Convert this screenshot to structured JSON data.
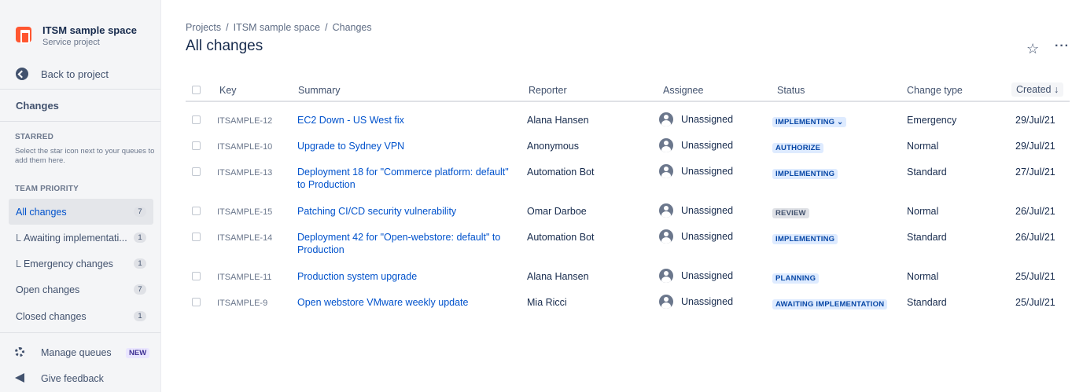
{
  "project": {
    "name": "ITSM sample space",
    "type": "Service project"
  },
  "sidebar": {
    "back_label": "Back to project",
    "section_title": "Changes",
    "starred_heading": "STARRED",
    "starred_hint": "Select the star icon next to your queues to add them here.",
    "team_priority_heading": "TEAM PRIORITY",
    "queues": [
      {
        "label": "All changes",
        "count": "7",
        "sub": false,
        "active": true
      },
      {
        "label": "Awaiting implementati...",
        "count": "1",
        "sub": true,
        "active": false
      },
      {
        "label": "Emergency changes",
        "count": "1",
        "sub": true,
        "active": false
      },
      {
        "label": "Open changes",
        "count": "7",
        "sub": false,
        "active": false
      },
      {
        "label": "Closed changes",
        "count": "1",
        "sub": false,
        "active": false
      }
    ],
    "manage_queues": "Manage queues",
    "new_badge": "NEW",
    "give_feedback": "Give feedback",
    "sub_prefix": "L"
  },
  "breadcrumb": [
    "Projects",
    "ITSM sample space",
    "Changes"
  ],
  "breadcrumb_sep": "/",
  "page_title": "All changes",
  "more_label": "···",
  "star_glyph": "☆",
  "table": {
    "headers": {
      "key": "Key",
      "summary": "Summary",
      "reporter": "Reporter",
      "assignee": "Assignee",
      "status": "Status",
      "change_type": "Change type",
      "created": "Created ↓"
    },
    "rows": [
      {
        "key": "ITSAMPLE-12",
        "summary": "EC2 Down - US West fix",
        "reporter": "Alana Hansen",
        "assignee": "Unassigned",
        "status": "IMPLEMENTING ⌄",
        "status_color": "blue",
        "change_type": "Emergency",
        "created": "29/Jul/21"
      },
      {
        "key": "ITSAMPLE-10",
        "summary": "Upgrade to Sydney VPN",
        "reporter": "Anonymous",
        "assignee": "Unassigned",
        "status": "AUTHORIZE",
        "status_color": "blue",
        "change_type": "Normal",
        "created": "29/Jul/21"
      },
      {
        "key": "ITSAMPLE-13",
        "summary": "Deployment 18 for \"Commerce platform: default\" to Production",
        "reporter": "Automation Bot",
        "assignee": "Unassigned",
        "status": "IMPLEMENTING",
        "status_color": "blue",
        "change_type": "Standard",
        "created": "27/Jul/21"
      },
      {
        "key": "ITSAMPLE-15",
        "summary": "Patching CI/CD security vulnerability",
        "reporter": "Omar Darboe",
        "assignee": "Unassigned",
        "status": "REVIEW",
        "status_color": "grey",
        "change_type": "Normal",
        "created": "26/Jul/21"
      },
      {
        "key": "ITSAMPLE-14",
        "summary": "Deployment 42 for \"Open-webstore: default\" to Production",
        "reporter": "Automation Bot",
        "assignee": "Unassigned",
        "status": "IMPLEMENTING",
        "status_color": "blue",
        "change_type": "Standard",
        "created": "26/Jul/21"
      },
      {
        "key": "ITSAMPLE-11",
        "summary": "Production system upgrade",
        "reporter": "Alana Hansen",
        "assignee": "Unassigned",
        "status": "PLANNING",
        "status_color": "blue",
        "change_type": "Normal",
        "created": "25/Jul/21"
      },
      {
        "key": "ITSAMPLE-9",
        "summary": "Open webstore VMware weekly update",
        "reporter": "Mia Ricci",
        "assignee": "Unassigned",
        "status": "AWAITING IMPLEMENTATION",
        "status_color": "blue",
        "change_type": "Standard",
        "created": "25/Jul/21"
      }
    ]
  }
}
